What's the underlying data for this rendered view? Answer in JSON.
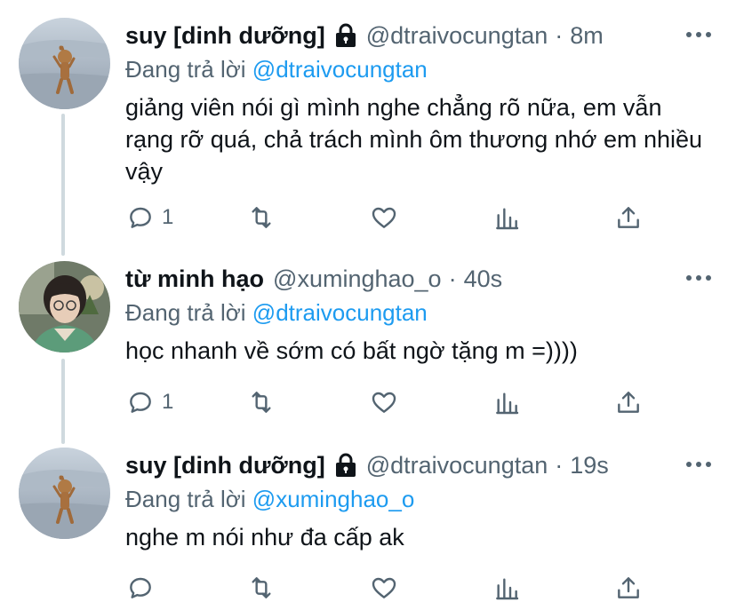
{
  "tweets": [
    {
      "display_name": "suy [dinh dưỡng]",
      "locked": true,
      "handle": "@dtraivocungtan",
      "separator": "·",
      "time": "8m",
      "reply_prefix": "Đang trả lời",
      "reply_to": "@dtraivocungtan",
      "text": "giảng viên nói gì mình nghe chẳng rõ nữa, em vẫn rạng rỡ quá, chả trách mình ôm thương nhớ em nhiều vậy",
      "reply_count": "1",
      "avatar": "cartoon-mouse-avatar"
    },
    {
      "display_name": "từ minh hạo",
      "locked": false,
      "handle": "@xuminghao_o",
      "separator": "·",
      "time": "40s",
      "reply_prefix": "Đang trả lời",
      "reply_to": "@dtraivocungtan",
      "text": "học nhanh về sớm có bất ngờ tặng m =))))",
      "reply_count": "1",
      "avatar": "person-photo-avatar"
    },
    {
      "display_name": "suy [dinh dưỡng]",
      "locked": true,
      "handle": "@dtraivocungtan",
      "separator": "·",
      "time": "19s",
      "reply_prefix": "Đang trả lời",
      "reply_to": "@xuminghao_o",
      "text": "nghe m nói như đa cấp ak",
      "reply_count": "",
      "avatar": "cartoon-mouse-avatar"
    }
  ],
  "icons": [
    "reply-icon",
    "retweet-icon",
    "like-icon",
    "analytics-icon",
    "share-icon",
    "more-icon",
    "lock-icon"
  ],
  "colors": {
    "accent": "#1d9bf0",
    "secondary_text": "#536471",
    "primary_text": "#0f1419",
    "thread_line": "#cfd9de"
  }
}
